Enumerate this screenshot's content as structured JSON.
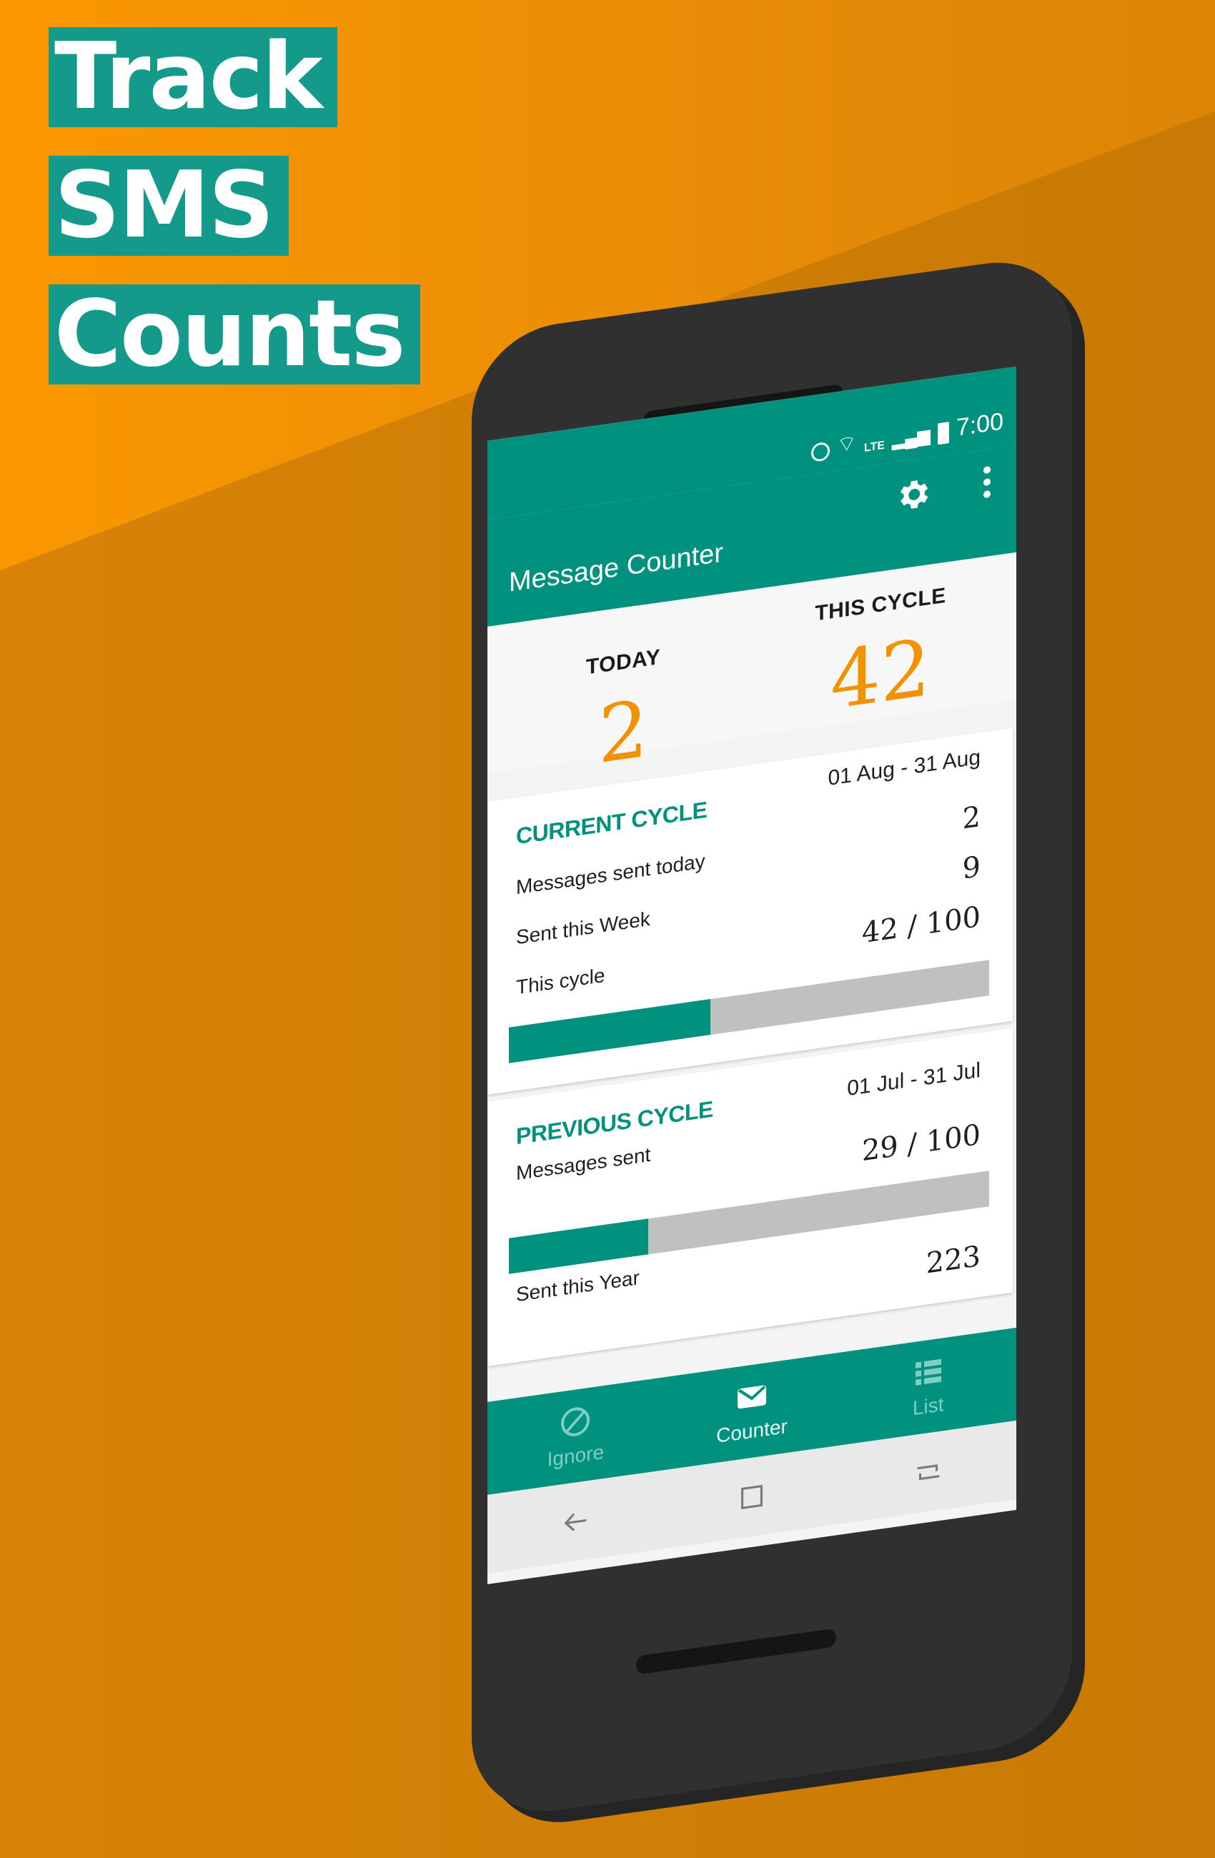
{
  "headline": {
    "line1": "Track",
    "line2": "SMS",
    "line3": "Counts"
  },
  "status_bar": {
    "time": "7:00",
    "network": "LTE"
  },
  "app_bar": {
    "title": "Message Counter"
  },
  "summary": {
    "today_label": "TODAY",
    "today_value": "2",
    "cycle_label": "THIS CYCLE",
    "cycle_value": "42"
  },
  "current_cycle": {
    "heading": "CURRENT CYCLE",
    "range": "01 Aug - 31 Aug",
    "rows": [
      {
        "label": "Messages sent today",
        "value": "2"
      },
      {
        "label": "Sent this Week",
        "value": "9"
      },
      {
        "label": "This cycle",
        "value": "42 / 100"
      }
    ],
    "progress_fraction": 0.42
  },
  "previous_cycle": {
    "heading": "PREVIOUS CYCLE",
    "range": "01 Jul - 31 Jul",
    "sent_label": "Messages sent",
    "sent_value": "29 / 100",
    "progress_fraction": 0.29,
    "year_label": "Sent this Year",
    "year_value": "223"
  },
  "bottom_nav": {
    "ignore": "Ignore",
    "counter": "Counter",
    "list": "List"
  },
  "colors": {
    "accent": "#00917f",
    "highlight": "#f39200",
    "background": "#f7a200"
  }
}
